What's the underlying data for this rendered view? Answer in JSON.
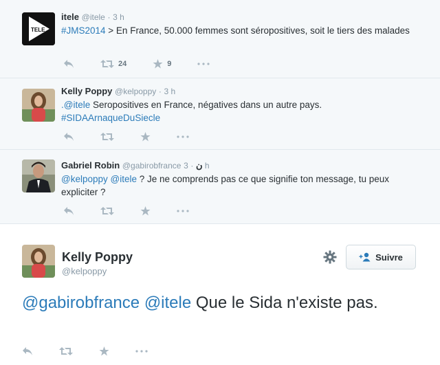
{
  "tweets": [
    {
      "name": "itele",
      "handle": "@itele",
      "time": "3 h",
      "hashtag": "#JMS2014",
      "text": " > En France, 50.000 femmes sont séropositives, soit le tiers des malades",
      "avatar_label": "TELE",
      "retweets": "24",
      "favorites": "9"
    },
    {
      "name": "Kelly Poppy",
      "handle": "@kelpoppy",
      "time": "3 h",
      "mention": ".@itele",
      "text": " Seropositives en France, négatives dans un autre pays.",
      "hashtag": "#SIDAArnaqueDuSiecle"
    },
    {
      "name": "Gabriel Robin",
      "handle": "@gabirobfrance",
      "badge": "ن",
      "time": "3 h",
      "mention1": "@kelpoppy",
      "mention2": "@itele",
      "text": " ? Je ne comprends pas ce que signifie ton message, tu peux expliciter ?"
    }
  ],
  "main_tweet": {
    "name": "Kelly Poppy",
    "handle": "@kelpoppy",
    "follow_label": "Suivre",
    "mention1": "@gabirobfrance",
    "mention2": "@itele",
    "text": " Que le Sida n'existe pas."
  },
  "colors": {
    "link": "#2b7bb9",
    "muted": "#8899a6",
    "icon": "#aab8c2",
    "background": "#f5f8fa"
  },
  "icons": [
    "reply-icon",
    "retweet-icon",
    "favorite-icon",
    "more-icon",
    "gear-icon",
    "follow-icon"
  ]
}
